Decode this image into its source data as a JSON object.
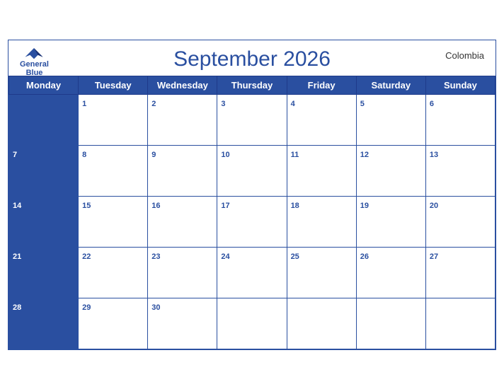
{
  "header": {
    "title": "September 2026",
    "country": "Colombia",
    "logo": {
      "line1": "General",
      "line2": "Blue"
    }
  },
  "weekdays": [
    "Monday",
    "Tuesday",
    "Wednesday",
    "Thursday",
    "Friday",
    "Saturday",
    "Sunday"
  ],
  "weeks": [
    [
      null,
      1,
      2,
      3,
      4,
      5,
      6
    ],
    [
      7,
      8,
      9,
      10,
      11,
      12,
      13
    ],
    [
      14,
      15,
      16,
      17,
      18,
      19,
      20
    ],
    [
      21,
      22,
      23,
      24,
      25,
      26,
      27
    ],
    [
      28,
      29,
      30,
      null,
      null,
      null,
      null
    ]
  ]
}
